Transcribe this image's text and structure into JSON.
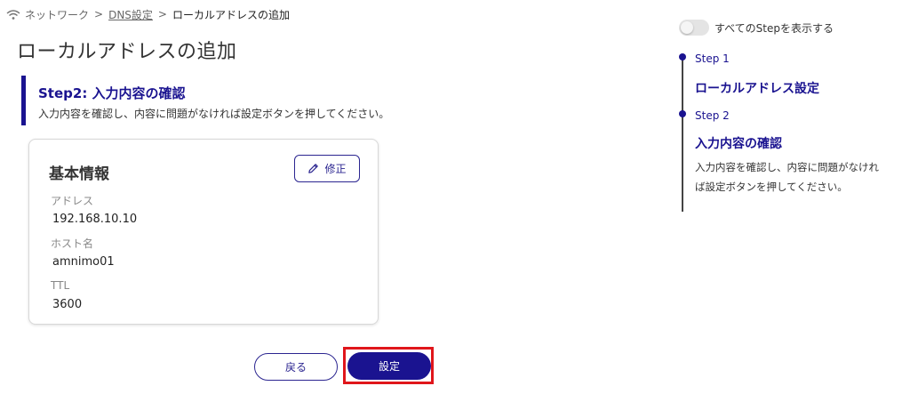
{
  "breadcrumb": {
    "network": "ネットワーク",
    "dns_settings": "DNS設定",
    "current": "ローカルアドレスの追加",
    "separator": ">"
  },
  "page_title": "ローカルアドレスの追加",
  "step_header": {
    "title": "Step2: 入力内容の確認",
    "description": "入力内容を確認し、内容に問題がなければ設定ボタンを押してください。"
  },
  "card": {
    "title": "基本情報",
    "edit_label": "修正",
    "fields": [
      {
        "label": "アドレス",
        "value": "192.168.10.10"
      },
      {
        "label": "ホスト名",
        "value": "amnimo01"
      },
      {
        "label": "TTL",
        "value": "3600"
      }
    ]
  },
  "actions": {
    "back_label": "戻る",
    "submit_label": "設定"
  },
  "sidebar": {
    "toggle_label": "すべてのStepを表示する",
    "toggle_on": false,
    "steps": [
      {
        "step": "Step 1",
        "title": "ローカルアドレス設定"
      },
      {
        "step": "Step 2",
        "title": "入力内容の確認",
        "description": "入力内容を確認し、内容に問題がなければ設定ボタンを押してください。"
      }
    ]
  },
  "colors": {
    "accent": "#1a1390",
    "highlight": "#e0161b"
  },
  "icons": {
    "breadcrumb_root": "wifi-icon",
    "edit": "pencil-icon"
  }
}
